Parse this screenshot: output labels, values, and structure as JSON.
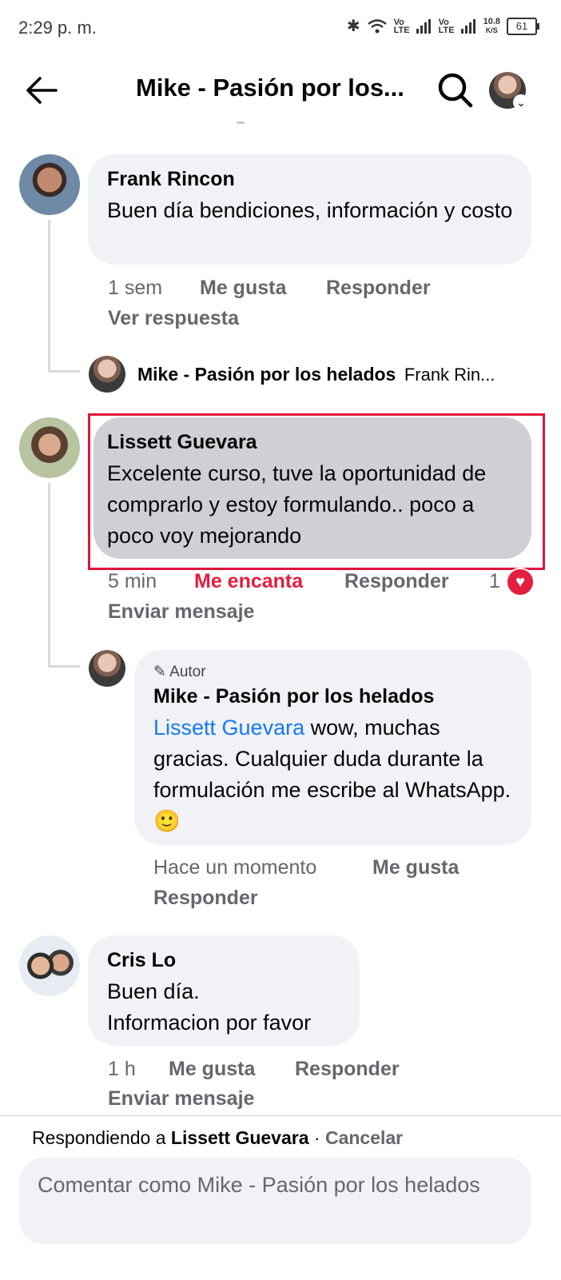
{
  "status_bar": {
    "time": "2:29 p. m.",
    "net_speed": "10.8",
    "net_unit": "K/S",
    "battery": "61",
    "volte1": "Vo\nLTE",
    "volte2": "Vo\nLTE"
  },
  "header": {
    "title": "Mike - Pasión por los..."
  },
  "comments": [
    {
      "name": "Frank Rincon",
      "text": "Buen día bendiciones, información y costo",
      "time": "1 sem",
      "like": "Me gusta",
      "reply": "Responder",
      "view_reply": "Ver respuesta",
      "reply_preview": {
        "name": "Mike - Pasión por los helados",
        "snippet": "Frank Rin..."
      }
    },
    {
      "name": "Lissett Guevara",
      "text": "Excelente curso, tuve la oportunidad de comprarlo y estoy formulando.. poco a poco voy mejorando",
      "time": "5 min",
      "like": "Me encanta",
      "reply": "Responder",
      "reaction_count": "1",
      "send_message": "Enviar mensaje",
      "reply_item": {
        "badge": "Autor",
        "name": "Mike - Pasión por los helados",
        "mention": "Lissett Guevara",
        "text": " wow, muchas gracias. Cualquier duda durante la formulación me escribe al WhatsApp. 🙂",
        "time": "Hace un momento",
        "like": "Me gusta",
        "reply": "Responder"
      }
    },
    {
      "name": "Cris Lo",
      "text_line1": "Buen día.",
      "text_line2": "Informacion por favor",
      "time": "1 h",
      "like": "Me gusta",
      "reply": "Responder",
      "send_message": "Enviar mensaje"
    }
  ],
  "composer": {
    "replying_prefix": "Respondiendo a ",
    "replying_to": "Lissett Guevara",
    "separator": " · ",
    "cancel": "Cancelar",
    "placeholder": "Comentar como Mike - Pasión por los helados"
  },
  "colors": {
    "highlight": "#e0143c",
    "love": "#e41e3f",
    "mention": "#1877f2"
  }
}
